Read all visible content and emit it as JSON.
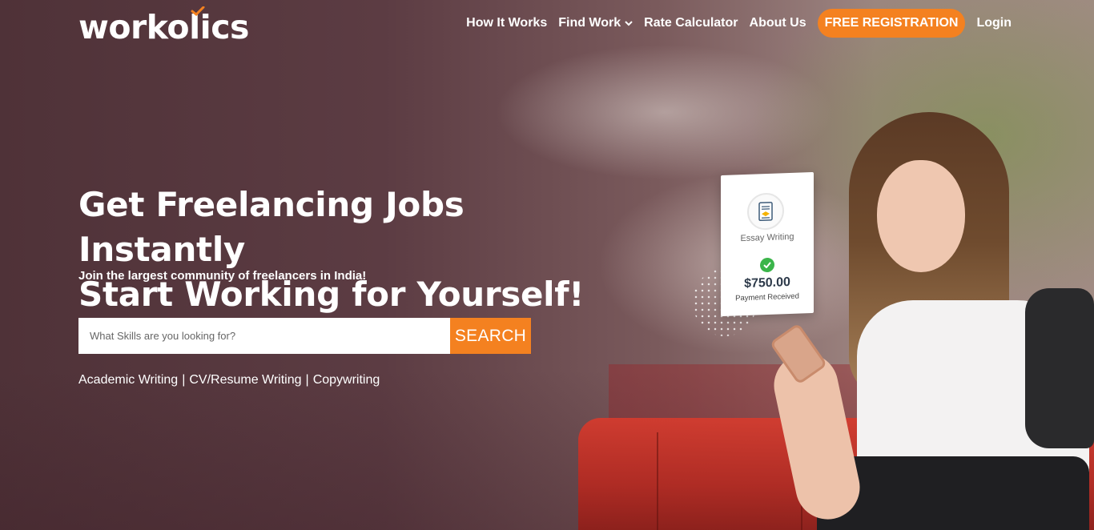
{
  "brand": {
    "logo_text": "workolics",
    "accent_color": "#f48120",
    "check_color": "#f48120"
  },
  "nav": {
    "items": [
      {
        "label": "How It Works"
      },
      {
        "label": "Find Work",
        "has_dropdown": true
      },
      {
        "label": "Rate Calculator"
      },
      {
        "label": "About Us"
      }
    ],
    "register_label": "FREE REGISTRATION",
    "login_label": "Login"
  },
  "hero": {
    "headline_line1": "Get Freelancing Jobs Instantly",
    "headline_line2": "Start Working for Yourself!",
    "subline": "Join the largest community of freelancers in India!",
    "search": {
      "placeholder": "What Skills are you looking for?",
      "value": "",
      "button_label": "SEARCH"
    },
    "tags": [
      "Academic Writing",
      "CV/Resume Writing",
      "Copywriting"
    ],
    "tag_separator": "|"
  },
  "payment_card": {
    "category": "Essay Writing",
    "amount": "$750.00",
    "status": "Payment Received",
    "status_color": "#3bb54a"
  }
}
